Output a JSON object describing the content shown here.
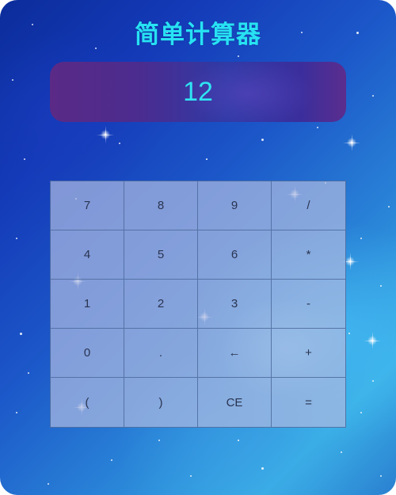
{
  "app": {
    "title": "简单计算器"
  },
  "display": {
    "value": "12"
  },
  "keypad": {
    "keys": [
      {
        "label": "7",
        "name": "key-7"
      },
      {
        "label": "8",
        "name": "key-8"
      },
      {
        "label": "9",
        "name": "key-9"
      },
      {
        "label": "/",
        "name": "key-divide"
      },
      {
        "label": "4",
        "name": "key-4"
      },
      {
        "label": "5",
        "name": "key-5"
      },
      {
        "label": "6",
        "name": "key-6"
      },
      {
        "label": "*",
        "name": "key-multiply"
      },
      {
        "label": "1",
        "name": "key-1"
      },
      {
        "label": "2",
        "name": "key-2"
      },
      {
        "label": "3",
        "name": "key-3"
      },
      {
        "label": "-",
        "name": "key-subtract"
      },
      {
        "label": "0",
        "name": "key-0"
      },
      {
        "label": ".",
        "name": "key-decimal"
      },
      {
        "label": "←",
        "name": "key-backspace"
      },
      {
        "label": "+",
        "name": "key-add"
      },
      {
        "label": "(",
        "name": "key-open-paren"
      },
      {
        "label": ")",
        "name": "key-close-paren"
      },
      {
        "label": "CE",
        "name": "key-clear"
      },
      {
        "label": "=",
        "name": "key-equals"
      }
    ]
  },
  "colors": {
    "accent": "#27e2f3",
    "key_text": "#2a3450"
  }
}
